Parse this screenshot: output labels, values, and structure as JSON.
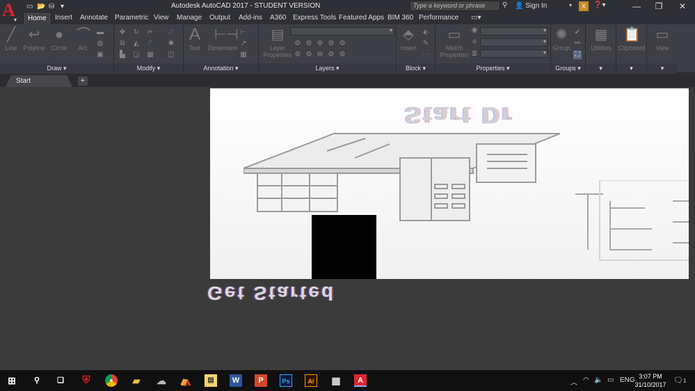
{
  "window": {
    "title": "Autodesk AutoCAD 2017 - STUDENT VERSION",
    "search_placeholder": "Type a keyword or phrase",
    "sign_in": "Sign In",
    "x_badge": "X"
  },
  "ribbon_tabs": [
    "Home",
    "Insert",
    "Annotate",
    "Parametric",
    "View",
    "Manage",
    "Output",
    "Add-ins",
    "A360",
    "Express Tools",
    "Featured Apps",
    "BIM 360",
    "Performance"
  ],
  "panels": {
    "draw": {
      "title": "Draw",
      "tools": [
        "Line",
        "Polyline",
        "Circle",
        "Arc"
      ]
    },
    "modify": {
      "title": "Modify"
    },
    "annotation": {
      "title": "Annotation",
      "tools": [
        "Text",
        "Dimension"
      ]
    },
    "layers": {
      "title": "Layers",
      "tools": [
        "Layer Properties"
      ]
    },
    "block": {
      "title": "Block",
      "tools": [
        "Insert"
      ]
    },
    "properties": {
      "title": "Properties",
      "tools": [
        "Match Properties"
      ]
    },
    "groups": {
      "title": "Groups",
      "tools": [
        "Group"
      ]
    },
    "utilities": {
      "title": "Utilities"
    },
    "clipboard": {
      "title": "Clipboard"
    },
    "view": {
      "title": "View"
    }
  },
  "file_tabs": {
    "start": "Start",
    "add": "+"
  },
  "start_page": {
    "heading": "Start Dr",
    "get_started": "Get Started"
  },
  "taskbar": {
    "language": "ENG",
    "time": "3:07 PM",
    "date": "31/10/2017",
    "notifications": "1",
    "app_labels": {
      "word": "W",
      "powerpoint": "P",
      "photoshop": "Ps",
      "illustrator": "Ai",
      "autocad": "A"
    }
  },
  "colors": {
    "titlebar": "#2f3036",
    "ribbon": "#3f4046",
    "workspace": "#3b3b3b",
    "taskbar": "#101010",
    "autocad_red": "#e0242c"
  }
}
